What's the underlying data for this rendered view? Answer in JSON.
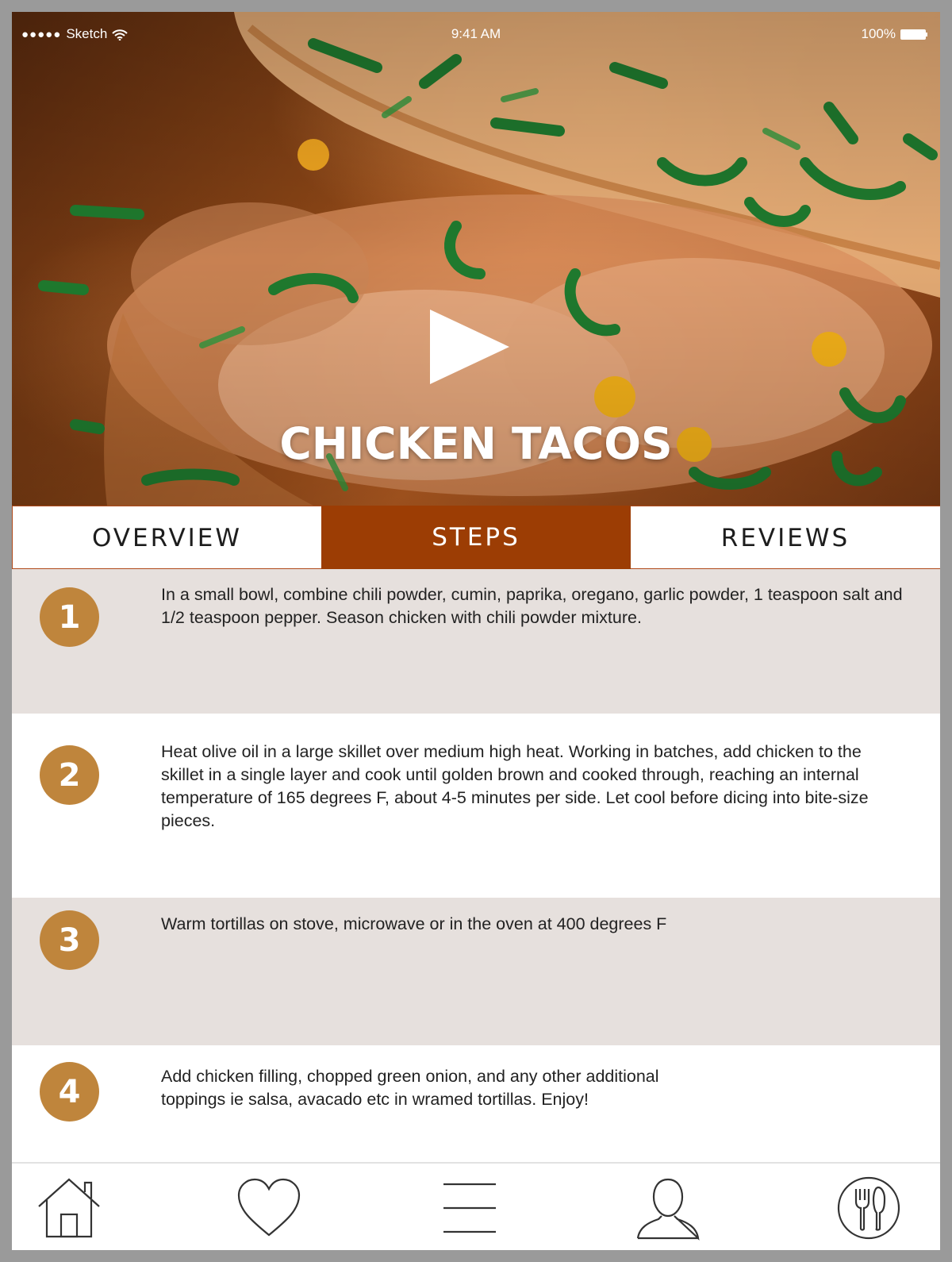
{
  "status_bar": {
    "carrier": "Sketch",
    "signal": "●●●●●",
    "time": "9:41 AM",
    "battery_percent": "100%",
    "icons": [
      "wifi-icon",
      "battery-icon"
    ]
  },
  "hero": {
    "title": "CHICKEN TACOS",
    "play_icon": "play-icon"
  },
  "tabs": [
    {
      "label": "OVERVIEW",
      "active": false
    },
    {
      "label": "STEPS",
      "active": true
    },
    {
      "label": "REVIEWS",
      "active": false
    }
  ],
  "steps": [
    {
      "number": "1",
      "text": "In a small bowl, combine chili powder, cumin, paprika, oregano, garlic powder, 1 teaspoon salt and 1/2 teaspoon pepper. Season chicken with chili powder mixture."
    },
    {
      "number": "2",
      "text": "Heat olive oil  in a large skillet over medium high heat. Working in batches, add chicken to the skillet in a single layer and cook until golden brown and cooked through, reaching an internal temperature of 165 degrees F, about 4-5 minutes per side. Let cool before dicing into bite-size pieces."
    },
    {
      "number": "3",
      "text": "Warm tortillas on stove, microwave or in the oven at 400 degrees F"
    },
    {
      "number": "4",
      "text": "Add chicken filling, chopped green onion, and any other additional toppings ie salsa, avacado etc in wramed tortillas. Enjoy!"
    }
  ],
  "bottom_nav": {
    "icons": [
      "home-icon",
      "heart-icon",
      "menu-icon",
      "profile-icon",
      "utensils-icon"
    ]
  },
  "colors": {
    "accent": "#9c3d04",
    "badge": "#bf853c",
    "shaded_row": "#e6e0dd",
    "frame": "#9a9a9a"
  }
}
